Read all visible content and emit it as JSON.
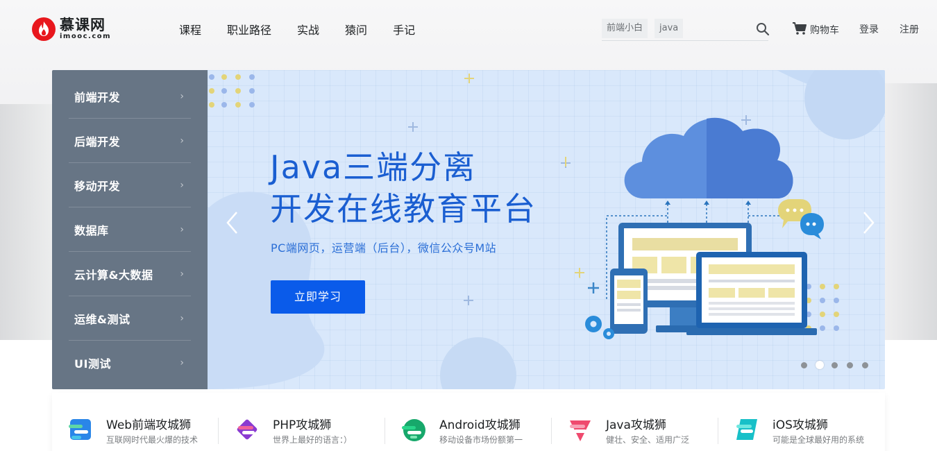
{
  "brand": {
    "name_cn": "慕课网",
    "name_en": "imooc.com",
    "color": "#e8171d"
  },
  "nav": {
    "items": [
      "课程",
      "职业路径",
      "实战",
      "猿问",
      "手记"
    ]
  },
  "search": {
    "tags": [
      "前端小白",
      "java"
    ],
    "icon": "search-icon"
  },
  "header_actions": {
    "cart_label": "购物车",
    "login_label": "登录",
    "register_label": "注册"
  },
  "sidebar": {
    "items": [
      {
        "label": "前端开发"
      },
      {
        "label": "后端开发"
      },
      {
        "label": "移动开发"
      },
      {
        "label": "数据库"
      },
      {
        "label": "云计算&大数据"
      },
      {
        "label": "运维&测试"
      },
      {
        "label": "UI测试"
      }
    ],
    "arrow": "›"
  },
  "banner": {
    "title_line1": "Java三端分离",
    "title_line2": "开发在线教育平台",
    "subtitle": "PC端网页，运营端（后台），微信公众号M站",
    "button_label": "立即学习",
    "accent_color": "#0a5bea",
    "dot_count": 5,
    "active_dot_index": 1
  },
  "categories": [
    {
      "title": "Web前端攻城狮",
      "desc": "互联网时代最火爆的技术",
      "icon": "web-frontend-icon"
    },
    {
      "title": "PHP攻城狮",
      "desc": "世界上最好的语言：）",
      "icon": "php-icon"
    },
    {
      "title": "Android攻城狮",
      "desc": "移动设备市场份额第一",
      "icon": "android-icon"
    },
    {
      "title": "Java攻城狮",
      "desc": "健壮、安全、适用广泛",
      "icon": "java-icon"
    },
    {
      "title": "iOS攻城狮",
      "desc": "可能是全球最好用的系统",
      "icon": "ios-icon"
    }
  ]
}
